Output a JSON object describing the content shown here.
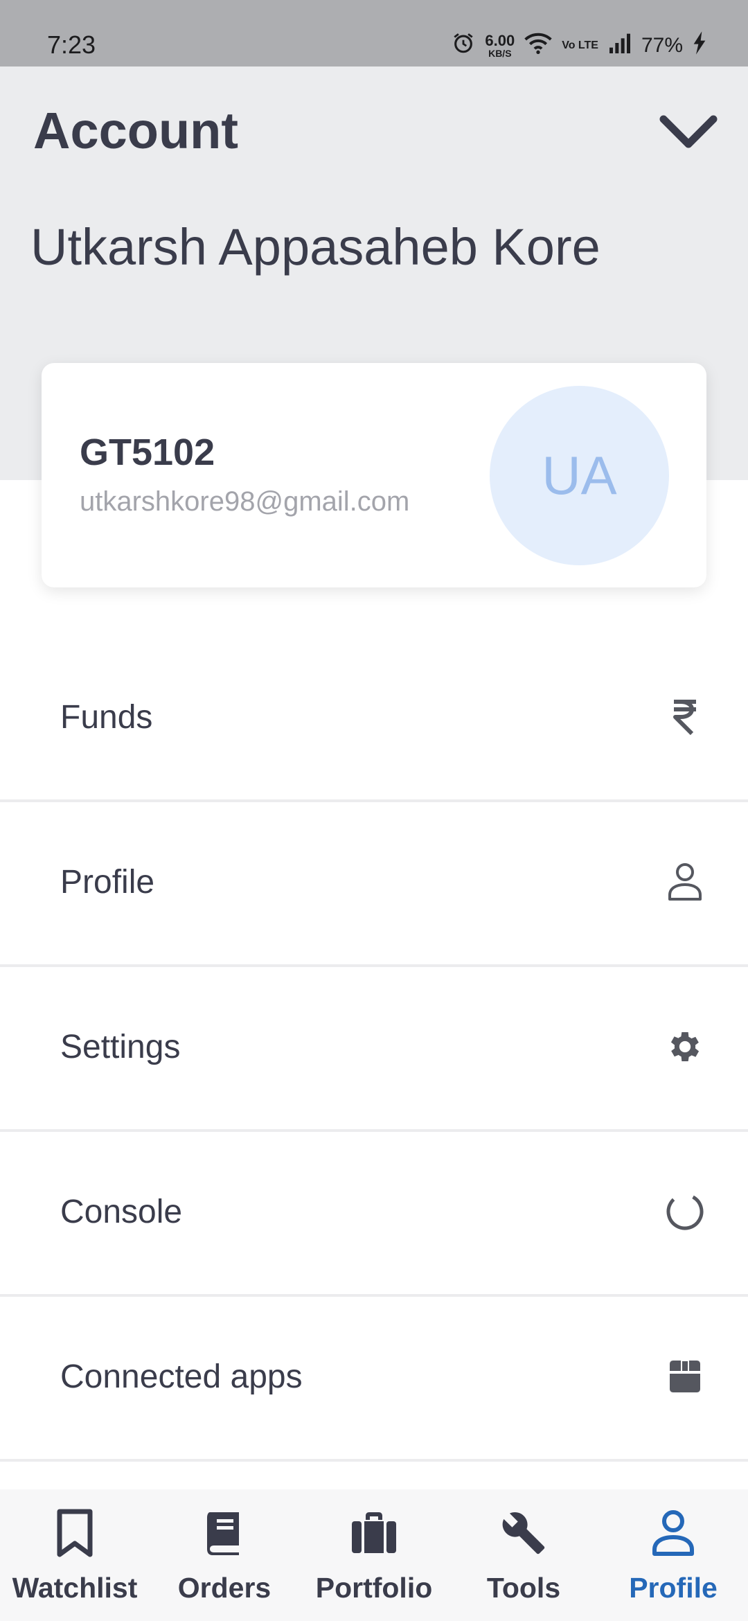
{
  "status_bar": {
    "time": "7:23",
    "net_speed_value": "6.00",
    "net_speed_unit": "KB/S",
    "volte": "Vo LTE",
    "battery": "77%"
  },
  "header": {
    "title": "Account",
    "user_name": "Utkarsh Appasaheb Kore",
    "collapse_icon": "chevron-down-icon"
  },
  "account_card": {
    "user_id": "GT5102",
    "email": "utkarshkore98@gmail.com",
    "avatar_initials": "UA"
  },
  "menu": {
    "items": [
      {
        "label": "Funds",
        "icon": "rupee-icon"
      },
      {
        "label": "Profile",
        "icon": "person-outline-icon"
      },
      {
        "label": "Settings",
        "icon": "gear-icon"
      },
      {
        "label": "Console",
        "icon": "circle-progress-icon"
      },
      {
        "label": "Connected apps",
        "icon": "box-icon"
      }
    ]
  },
  "bottom_nav": {
    "items": [
      {
        "label": "Watchlist",
        "icon": "bookmark-icon",
        "active": false
      },
      {
        "label": "Orders",
        "icon": "book-icon",
        "active": false
      },
      {
        "label": "Portfolio",
        "icon": "briefcase-icon",
        "active": false
      },
      {
        "label": "Tools",
        "icon": "wrench-icon",
        "active": false
      },
      {
        "label": "Profile",
        "icon": "person-icon",
        "active": true
      }
    ]
  },
  "colors": {
    "accent": "#2568b8",
    "header_bg": "#ebecee",
    "text": "#3a3c4b",
    "muted": "#a3a4ab",
    "avatar_bg": "#e4eefc",
    "avatar_text": "#9bbcec"
  }
}
